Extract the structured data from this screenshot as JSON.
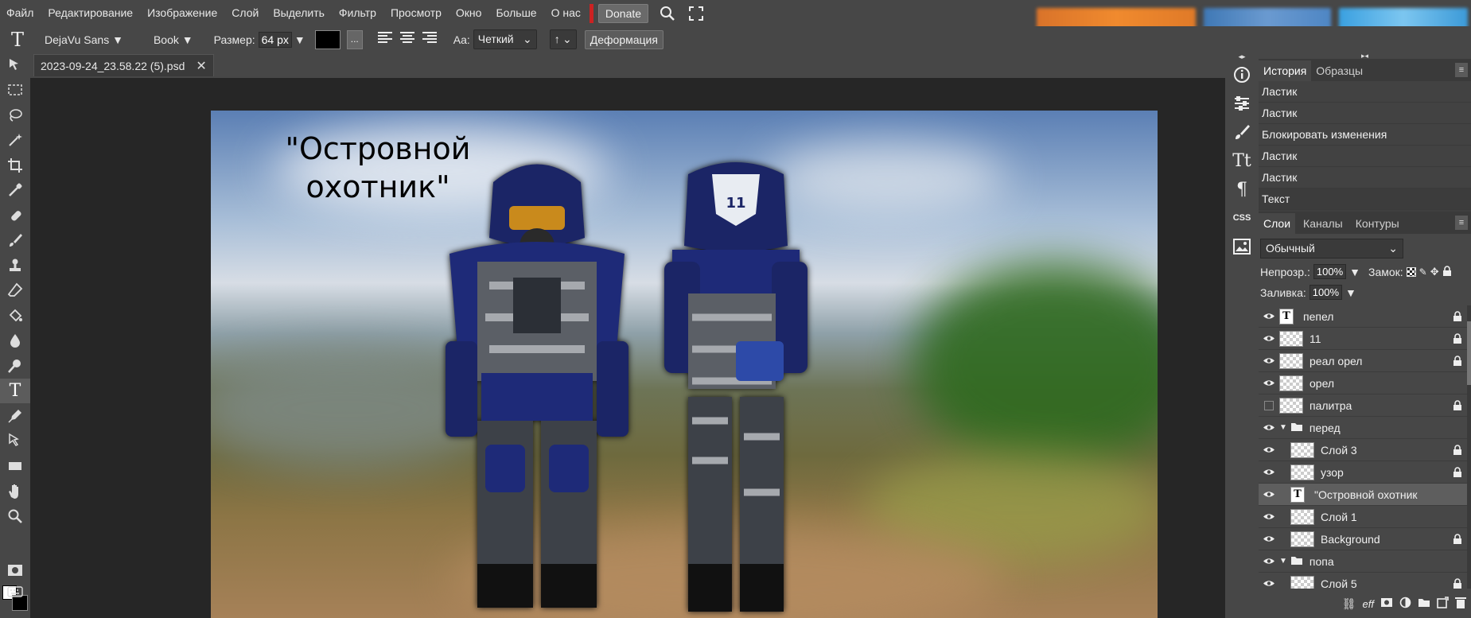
{
  "menu": {
    "items": [
      "Файл",
      "Редактирование",
      "Изображение",
      "Слой",
      "Выделить",
      "Фильтр",
      "Просмотр",
      "Окно",
      "Больше",
      "О нас"
    ],
    "donate": "Donate"
  },
  "options": {
    "font": "DejaVu Sans",
    "weight": "Book",
    "size_label": "Размер:",
    "size_value": "64 px",
    "more": "...",
    "aa_label": "Aa:",
    "aa_value": "Четкий",
    "baseline": "↑",
    "deform": "Деформация",
    "color": "#000000"
  },
  "document": {
    "tab_title": "2023-09-24_23.58.22 (5).psd",
    "caption_line1": "\"Островной",
    "caption_line2": "охотник\""
  },
  "panels": {
    "history_tabs": [
      "История",
      "Образцы"
    ],
    "history": [
      "Ластик",
      "Ластик",
      "Блокировать изменения",
      "Ластик",
      "Ластик",
      "Текст"
    ],
    "layer_tabs": [
      "Слои",
      "Каналы",
      "Контуры"
    ],
    "blend_mode": "Обычный",
    "opacity_label": "Непрозр.:",
    "opacity_value": "100%",
    "lock_label": "Замок:",
    "fill_label": "Заливка:",
    "fill_value": "100%",
    "layers": [
      {
        "name": "пепел",
        "type": "text",
        "visible": true,
        "locked": true
      },
      {
        "name": "11",
        "type": "raster",
        "visible": true,
        "locked": true
      },
      {
        "name": "реал орел",
        "type": "raster",
        "visible": true,
        "locked": true
      },
      {
        "name": "орел",
        "type": "raster",
        "visible": true,
        "locked": false
      },
      {
        "name": "палитра",
        "type": "raster",
        "visible": false,
        "locked": true
      },
      {
        "name": "перед",
        "type": "folder",
        "visible": true,
        "locked": false
      },
      {
        "name": "Слой 3",
        "type": "raster",
        "visible": true,
        "locked": true
      },
      {
        "name": "узор",
        "type": "raster",
        "visible": true,
        "locked": true
      },
      {
        "name": "\"Островной охотник",
        "type": "text",
        "visible": true,
        "locked": false,
        "selected": true
      },
      {
        "name": "Слой 1",
        "type": "raster",
        "visible": true,
        "locked": false
      },
      {
        "name": "Background",
        "type": "raster",
        "visible": true,
        "locked": true
      },
      {
        "name": "попа",
        "type": "folder",
        "visible": true,
        "locked": false
      },
      {
        "name": "Слой 5",
        "type": "raster",
        "visible": true,
        "locked": true
      }
    ]
  }
}
